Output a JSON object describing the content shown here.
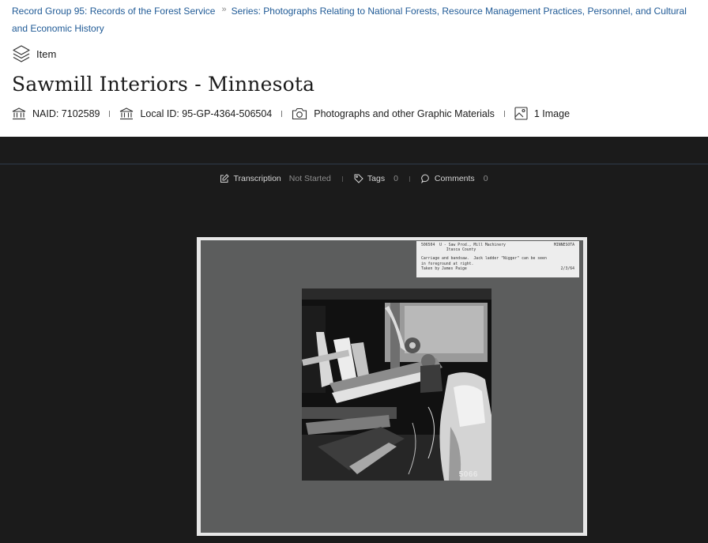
{
  "breadcrumb": {
    "record_group": "Record Group 95: Records of the Forest Service",
    "series": "Series: Photographs Relating to National Forests, Resource Management Practices, Personnel, and Cultural and Economic History",
    "separator": "»"
  },
  "item_type": {
    "label": "Item",
    "icon": "layers-icon"
  },
  "title": "Sawmill Interiors - Minnesota",
  "meta": {
    "naid": "NAID: 7102589",
    "local_id": "Local ID: 95-GP-4364-506504",
    "media_type": "Photographs and other Graphic Materials",
    "image_count": "1 Image"
  },
  "viewer_toolbar": {
    "transcription_label": "Transcription",
    "transcription_status": "Not Started",
    "tags_label": "Tags",
    "tags_count": "0",
    "comments_label": "Comments",
    "comments_count": "0"
  },
  "photo": {
    "card_line1_left": "506504  U - Saw Prod., Mill Machinery",
    "card_line1_right": "MINNESOTA",
    "card_line2": "           Itasca County",
    "card_line3": "Carriage and bandsaw.  Jack ladder \"Nigger\" can be seen",
    "card_line4": "in foreground at right.",
    "card_line5_left": "Taken by James Paige",
    "card_line5_right": "2/3/64",
    "print_number": "5066"
  },
  "colors": {
    "link": "#1f5a96",
    "viewer_bg": "#1b1b1b",
    "board": "#5c5d5d"
  }
}
